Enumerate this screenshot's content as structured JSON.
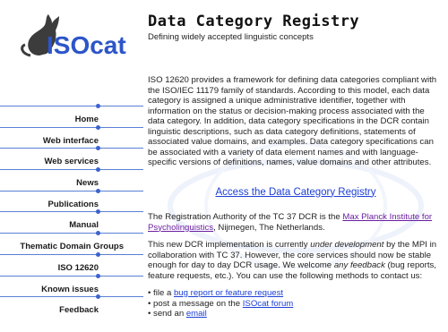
{
  "logo": {
    "text": "ISOcat"
  },
  "header": {
    "title": "Data Category Registry",
    "subtitle": "Defining widely accepted linguistic concepts"
  },
  "nav": {
    "items": [
      {
        "label": "Home"
      },
      {
        "label": "Web interface"
      },
      {
        "label": "Web services"
      },
      {
        "label": "News"
      },
      {
        "label": "Publications"
      },
      {
        "label": "Manual"
      },
      {
        "label": "Thematic Domain Groups"
      },
      {
        "label": "ISO 12620"
      },
      {
        "label": "Known issues"
      },
      {
        "label": "Feedback"
      }
    ]
  },
  "content": {
    "intro": "ISO 12620 provides a framework for defining data categories compliant with the ISO/IEC 11179 family of standards. According to this model, each data category is assigned a unique administrative identifier, together with information on the status or decision-making process associated with the data category. In addition, data category specifications in the DCR contain linguistic descriptions, such as data category definitions, statements of associated value domains, and examples. Data category specifications can be associated with a variety of data element names and with language-specific versions of definitions, names, value domains and other attributes.",
    "access_link": "Access the Data Category Registry",
    "ra_prefix": "The Registration Authority of the TC 37 DCR is the ",
    "ra_link": "Max Planck Institute for Psycholinguistics",
    "ra_suffix": ", Nijmegen, The Netherlands.",
    "dev_1": "This new DCR implementation is currently ",
    "dev_em1": "under development",
    "dev_2": " by the MPI in collaboration with TC 37. However, the core services should now be stable enough for day to day DCR usage. We welcome ",
    "dev_em2": "any feedback",
    "dev_3": " (bug reports, feature requests, etc.). You can use the following methods to contact us:",
    "bullet1_pre": "file a ",
    "bullet1_link": "bug report or feature request",
    "bullet2_pre": "post a message on the ",
    "bullet2_link": "ISOcat forum",
    "bullet3_pre": "send an ",
    "bullet3_link": "email"
  }
}
